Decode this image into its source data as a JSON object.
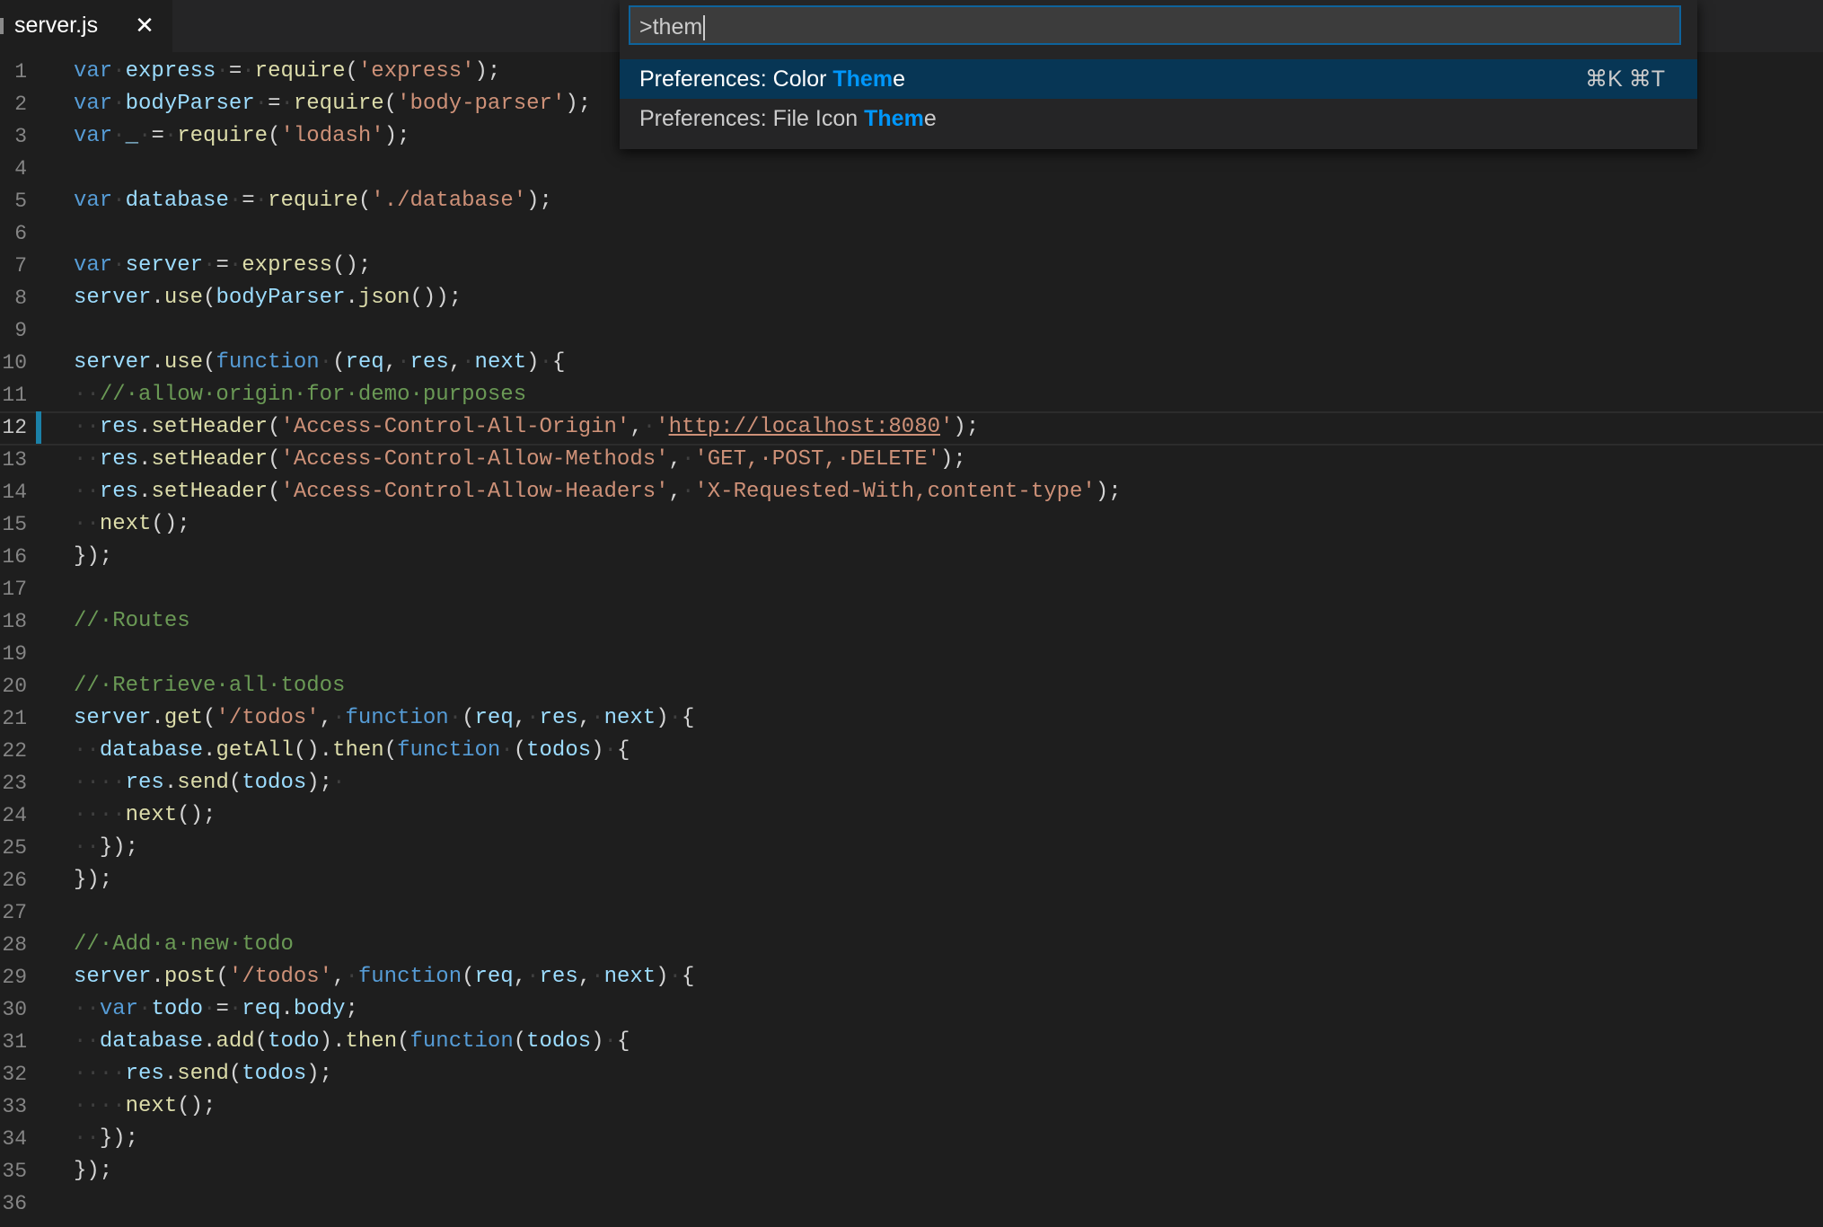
{
  "tab": {
    "filename": "server.js",
    "close_glyph": "✕"
  },
  "palette": {
    "query": ">them",
    "items": [
      {
        "prefix": "Preferences: Color ",
        "match": "Them",
        "suffix": "e",
        "keybinding": "⌘K ⌘T"
      },
      {
        "prefix": "Preferences: File Icon ",
        "match": "Them",
        "suffix": "e",
        "keybinding": ""
      }
    ]
  },
  "editor": {
    "current_line": 12,
    "lines": [
      [
        [
          "kw",
          "var"
        ],
        [
          "ws",
          "·"
        ],
        [
          "id",
          "express"
        ],
        [
          "ws",
          "·"
        ],
        [
          "p",
          "="
        ],
        [
          "ws",
          "·"
        ],
        [
          "fn",
          "require"
        ],
        [
          "p",
          "("
        ],
        [
          "str",
          "'express'"
        ],
        [
          "p",
          ");"
        ]
      ],
      [
        [
          "kw",
          "var"
        ],
        [
          "ws",
          "·"
        ],
        [
          "id",
          "bodyParser"
        ],
        [
          "ws",
          "·"
        ],
        [
          "p",
          "="
        ],
        [
          "ws",
          "·"
        ],
        [
          "fn",
          "require"
        ],
        [
          "p",
          "("
        ],
        [
          "str",
          "'body-parser'"
        ],
        [
          "p",
          ");"
        ]
      ],
      [
        [
          "kw",
          "var"
        ],
        [
          "ws",
          "·"
        ],
        [
          "id",
          "_"
        ],
        [
          "ws",
          "·"
        ],
        [
          "p",
          "="
        ],
        [
          "ws",
          "·"
        ],
        [
          "fn",
          "require"
        ],
        [
          "p",
          "("
        ],
        [
          "str",
          "'lodash'"
        ],
        [
          "p",
          ");"
        ]
      ],
      [],
      [
        [
          "kw",
          "var"
        ],
        [
          "ws",
          "·"
        ],
        [
          "id",
          "database"
        ],
        [
          "ws",
          "·"
        ],
        [
          "p",
          "="
        ],
        [
          "ws",
          "·"
        ],
        [
          "fn",
          "require"
        ],
        [
          "p",
          "("
        ],
        [
          "str",
          "'./database'"
        ],
        [
          "p",
          ");"
        ]
      ],
      [],
      [
        [
          "kw",
          "var"
        ],
        [
          "ws",
          "·"
        ],
        [
          "id",
          "server"
        ],
        [
          "ws",
          "·"
        ],
        [
          "p",
          "="
        ],
        [
          "ws",
          "·"
        ],
        [
          "fn",
          "express"
        ],
        [
          "p",
          "();"
        ]
      ],
      [
        [
          "id",
          "server"
        ],
        [
          "p",
          "."
        ],
        [
          "fn",
          "use"
        ],
        [
          "p",
          "("
        ],
        [
          "id",
          "bodyParser"
        ],
        [
          "p",
          "."
        ],
        [
          "fn",
          "json"
        ],
        [
          "p",
          "());"
        ]
      ],
      [],
      [
        [
          "id",
          "server"
        ],
        [
          "p",
          "."
        ],
        [
          "fn",
          "use"
        ],
        [
          "p",
          "("
        ],
        [
          "kw",
          "function"
        ],
        [
          "ws",
          "·"
        ],
        [
          "p",
          "("
        ],
        [
          "id",
          "req"
        ],
        [
          "p",
          ","
        ],
        [
          "ws",
          "·"
        ],
        [
          "id",
          "res"
        ],
        [
          "p",
          ","
        ],
        [
          "ws",
          "·"
        ],
        [
          "id",
          "next"
        ],
        [
          "p",
          ")"
        ],
        [
          "ws",
          "·"
        ],
        [
          "p",
          "{"
        ]
      ],
      [
        [
          "ws",
          "··"
        ],
        [
          "cm",
          "//·allow·origin·for·demo·purposes"
        ]
      ],
      [
        [
          "ws",
          "··"
        ],
        [
          "id",
          "res"
        ],
        [
          "p",
          "."
        ],
        [
          "fn",
          "setHeader"
        ],
        [
          "p",
          "("
        ],
        [
          "str",
          "'Access-Control-All-Origin'"
        ],
        [
          "p",
          ","
        ],
        [
          "ws",
          "·"
        ],
        [
          "str",
          "'"
        ],
        [
          "url",
          "http://localhost:8080"
        ],
        [
          "str",
          "'"
        ],
        [
          "p",
          ");"
        ]
      ],
      [
        [
          "ws",
          "··"
        ],
        [
          "id",
          "res"
        ],
        [
          "p",
          "."
        ],
        [
          "fn",
          "setHeader"
        ],
        [
          "p",
          "("
        ],
        [
          "str",
          "'Access-Control-Allow-Methods'"
        ],
        [
          "p",
          ","
        ],
        [
          "ws",
          "·"
        ],
        [
          "str",
          "'GET,·POST,·DELETE'"
        ],
        [
          "p",
          ");"
        ]
      ],
      [
        [
          "ws",
          "··"
        ],
        [
          "id",
          "res"
        ],
        [
          "p",
          "."
        ],
        [
          "fn",
          "setHeader"
        ],
        [
          "p",
          "("
        ],
        [
          "str",
          "'Access-Control-Allow-Headers'"
        ],
        [
          "p",
          ","
        ],
        [
          "ws",
          "·"
        ],
        [
          "str",
          "'X-Requested-With,content-type'"
        ],
        [
          "p",
          ");"
        ]
      ],
      [
        [
          "ws",
          "··"
        ],
        [
          "fn",
          "next"
        ],
        [
          "p",
          "();"
        ]
      ],
      [
        [
          "p",
          "});"
        ]
      ],
      [],
      [
        [
          "cm",
          "//·Routes"
        ]
      ],
      [],
      [
        [
          "cm",
          "//·Retrieve·all·todos"
        ]
      ],
      [
        [
          "id",
          "server"
        ],
        [
          "p",
          "."
        ],
        [
          "fn",
          "get"
        ],
        [
          "p",
          "("
        ],
        [
          "str",
          "'/todos'"
        ],
        [
          "p",
          ","
        ],
        [
          "ws",
          "·"
        ],
        [
          "kw",
          "function"
        ],
        [
          "ws",
          "·"
        ],
        [
          "p",
          "("
        ],
        [
          "id",
          "req"
        ],
        [
          "p",
          ","
        ],
        [
          "ws",
          "·"
        ],
        [
          "id",
          "res"
        ],
        [
          "p",
          ","
        ],
        [
          "ws",
          "·"
        ],
        [
          "id",
          "next"
        ],
        [
          "p",
          ")"
        ],
        [
          "ws",
          "·"
        ],
        [
          "p",
          "{"
        ]
      ],
      [
        [
          "ws",
          "··"
        ],
        [
          "id",
          "database"
        ],
        [
          "p",
          "."
        ],
        [
          "fn",
          "getAll"
        ],
        [
          "p",
          "()."
        ],
        [
          "fn",
          "then"
        ],
        [
          "p",
          "("
        ],
        [
          "kw",
          "function"
        ],
        [
          "ws",
          "·"
        ],
        [
          "p",
          "("
        ],
        [
          "id",
          "todos"
        ],
        [
          "p",
          ")"
        ],
        [
          "ws",
          "·"
        ],
        [
          "p",
          "{"
        ]
      ],
      [
        [
          "ws",
          "····"
        ],
        [
          "id",
          "res"
        ],
        [
          "p",
          "."
        ],
        [
          "fn",
          "send"
        ],
        [
          "p",
          "("
        ],
        [
          "id",
          "todos"
        ],
        [
          "p",
          ");"
        ],
        [
          "ws",
          "·"
        ]
      ],
      [
        [
          "ws",
          "····"
        ],
        [
          "fn",
          "next"
        ],
        [
          "p",
          "();"
        ]
      ],
      [
        [
          "ws",
          "··"
        ],
        [
          "p",
          "});"
        ]
      ],
      [
        [
          "p",
          "});"
        ]
      ],
      [],
      [
        [
          "cm",
          "//·Add·a·new·todo"
        ]
      ],
      [
        [
          "id",
          "server"
        ],
        [
          "p",
          "."
        ],
        [
          "fn",
          "post"
        ],
        [
          "p",
          "("
        ],
        [
          "str",
          "'/todos'"
        ],
        [
          "p",
          ","
        ],
        [
          "ws",
          "·"
        ],
        [
          "kw",
          "function"
        ],
        [
          "p",
          "("
        ],
        [
          "id",
          "req"
        ],
        [
          "p",
          ","
        ],
        [
          "ws",
          "·"
        ],
        [
          "id",
          "res"
        ],
        [
          "p",
          ","
        ],
        [
          "ws",
          "·"
        ],
        [
          "id",
          "next"
        ],
        [
          "p",
          ")"
        ],
        [
          "ws",
          "·"
        ],
        [
          "p",
          "{"
        ]
      ],
      [
        [
          "ws",
          "··"
        ],
        [
          "kw",
          "var"
        ],
        [
          "ws",
          "·"
        ],
        [
          "id",
          "todo"
        ],
        [
          "ws",
          "·"
        ],
        [
          "p",
          "="
        ],
        [
          "ws",
          "·"
        ],
        [
          "id",
          "req"
        ],
        [
          "p",
          "."
        ],
        [
          "id",
          "body"
        ],
        [
          "p",
          ";"
        ]
      ],
      [
        [
          "ws",
          "··"
        ],
        [
          "id",
          "database"
        ],
        [
          "p",
          "."
        ],
        [
          "fn",
          "add"
        ],
        [
          "p",
          "("
        ],
        [
          "id",
          "todo"
        ],
        [
          "p",
          ")."
        ],
        [
          "fn",
          "then"
        ],
        [
          "p",
          "("
        ],
        [
          "kw",
          "function"
        ],
        [
          "p",
          "("
        ],
        [
          "id",
          "todos"
        ],
        [
          "p",
          ")"
        ],
        [
          "ws",
          "·"
        ],
        [
          "p",
          "{"
        ]
      ],
      [
        [
          "ws",
          "····"
        ],
        [
          "id",
          "res"
        ],
        [
          "p",
          "."
        ],
        [
          "fn",
          "send"
        ],
        [
          "p",
          "("
        ],
        [
          "id",
          "todos"
        ],
        [
          "p",
          ");"
        ]
      ],
      [
        [
          "ws",
          "····"
        ],
        [
          "fn",
          "next"
        ],
        [
          "p",
          "();"
        ]
      ],
      [
        [
          "ws",
          "··"
        ],
        [
          "p",
          "});"
        ]
      ],
      [
        [
          "p",
          "});"
        ]
      ],
      []
    ]
  }
}
